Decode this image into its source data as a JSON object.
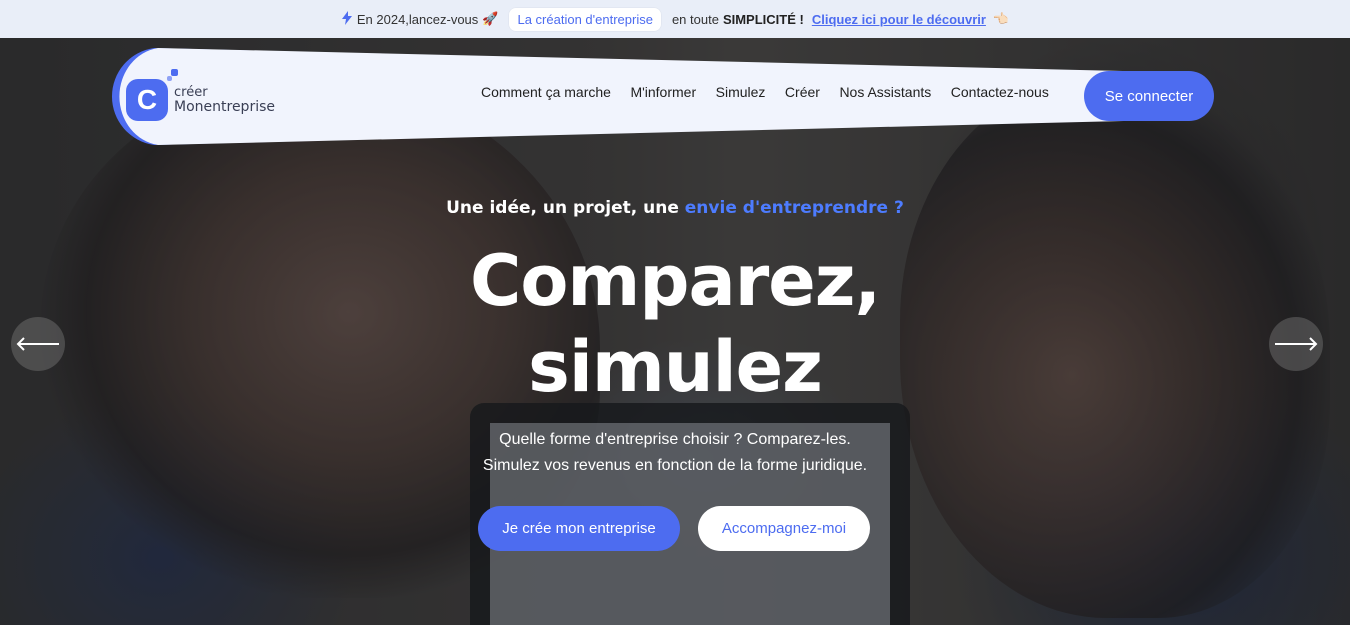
{
  "announcement": {
    "text_before": "En 2024,lancez-vous",
    "rocket_icon": "🚀",
    "pill": "La création d'entreprise",
    "text_middle": "en toute",
    "bold": "SIMPLICITÉ !",
    "link": "Cliquez ici pour le découvrir",
    "hand_icon": "👈🏻"
  },
  "logo": {
    "line1": "créer",
    "line2": "Monentreprise"
  },
  "nav": {
    "items": [
      "Comment ça marche",
      "M'informer",
      "Simulez",
      "Créer",
      "Nos Assistants",
      "Contactez-nous"
    ],
    "connect_label": "Se connecter"
  },
  "hero": {
    "eyebrow_main": "Une idée, un projet, une ",
    "eyebrow_accent": "envie d'entreprendre ?",
    "headline_line1": "Comparez,",
    "headline_line2": "simulez",
    "sub_line1": "Quelle forme d'entreprise choisir ? Comparez-les.",
    "sub_line2": "Simulez vos revenus en fonction de la forme juridique.",
    "cta_primary": "Je crée mon entreprise",
    "cta_secondary": "Accompagnez-moi"
  },
  "colors": {
    "accent": "#4d6cf0",
    "accent_text": "#4d7cff",
    "topbar_bg": "#e9eef8",
    "nav_bg": "#f1f4fd"
  },
  "icons": {
    "bolt": "lightning-icon",
    "prev": "arrow-left-icon",
    "next": "arrow-right-icon"
  }
}
